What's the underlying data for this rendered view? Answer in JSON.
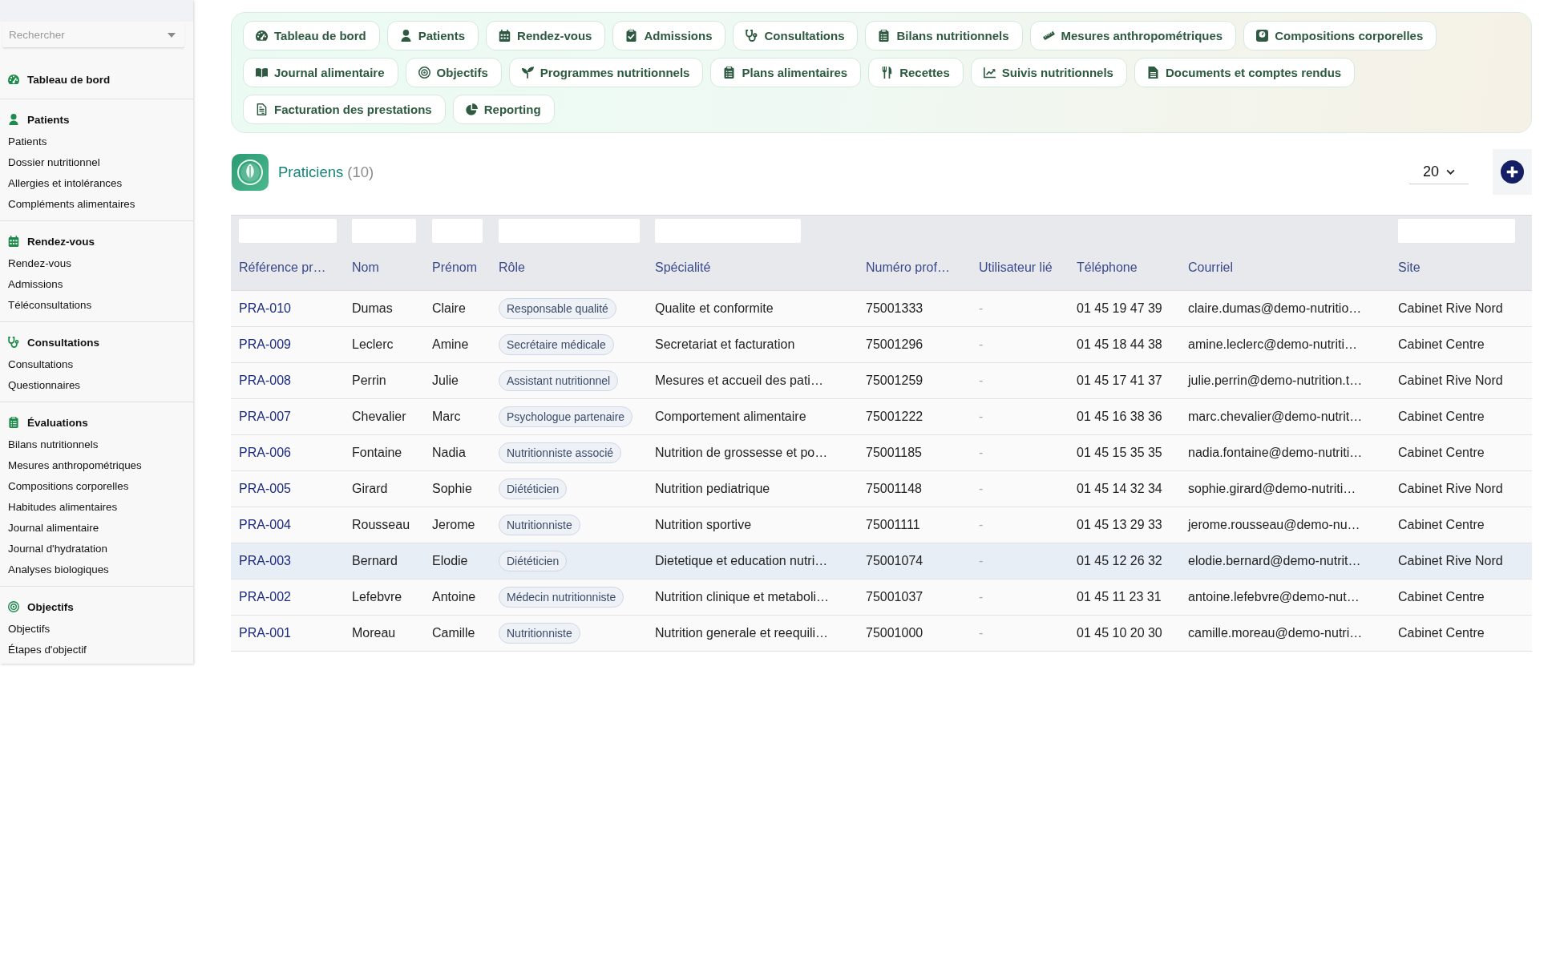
{
  "sidebar": {
    "search": {
      "placeholder": "Rechercher"
    },
    "sections": [
      {
        "title": "Tableau de bord"
      },
      {
        "title": "Patients",
        "items": [
          "Patients",
          "Dossier nutritionnel",
          "Allergies et intolérances",
          "Compléments alimentaires"
        ]
      },
      {
        "title": "Rendez-vous",
        "items": [
          "Rendez-vous",
          "Admissions",
          "Téléconsultations"
        ]
      },
      {
        "title": "Consultations",
        "items": [
          "Consultations",
          "Questionnaires"
        ]
      },
      {
        "title": "Évaluations",
        "items": [
          "Bilans nutritionnels",
          "Mesures anthropométriques",
          "Compositions corporelles",
          "Habitudes alimentaires",
          "Journal alimentaire",
          "Journal d'hydratation",
          "Analyses biologiques"
        ]
      },
      {
        "title": "Objectifs",
        "items": [
          "Objectifs",
          "Étapes d'objectif"
        ]
      }
    ]
  },
  "nav_buttons": [
    "Tableau de bord",
    "Patients",
    "Rendez-vous",
    "Admissions",
    "Consultations",
    "Bilans nutritionnels",
    "Mesures anthropométriques",
    "Compositions corporelles",
    "Journal alimentaire",
    "Objectifs",
    "Programmes nutritionnels",
    "Plans alimentaires",
    "Recettes",
    "Suivis nutritionnels",
    "Documents et comptes rendus",
    "Facturation des prestations",
    "Reporting"
  ],
  "page": {
    "title": "Praticiens",
    "count": "(10)",
    "per_page": "20"
  },
  "table": {
    "columns": [
      {
        "label": "Référence pr…",
        "kind": "link",
        "filter": true
      },
      {
        "label": "Nom",
        "kind": "text",
        "filter": true
      },
      {
        "label": "Prénom",
        "kind": "text",
        "filter": true
      },
      {
        "label": "Rôle",
        "kind": "badge",
        "filter": true
      },
      {
        "label": "Spécialité",
        "kind": "text",
        "filter": true
      },
      {
        "label": "Numéro prof…",
        "kind": "text",
        "filter": false
      },
      {
        "label": "Utilisateur lié",
        "kind": "muted",
        "filter": false
      },
      {
        "label": "Téléphone",
        "kind": "text",
        "filter": false
      },
      {
        "label": "Courriel",
        "kind": "text",
        "filter": false
      },
      {
        "label": "Site",
        "kind": "text",
        "filter": true
      }
    ],
    "rows": [
      {
        "selected": false,
        "cells": [
          "PRA-010",
          "Dumas",
          "Claire",
          "Responsable qualité",
          "Qualite et conformite",
          "75001333",
          "-",
          "01 45 19 47 39",
          "claire.dumas@demo-nutritio…",
          "Cabinet Rive Nord"
        ]
      },
      {
        "selected": false,
        "cells": [
          "PRA-009",
          "Leclerc",
          "Amine",
          "Secrétaire médicale",
          "Secretariat et facturation",
          "75001296",
          "-",
          "01 45 18 44 38",
          "amine.leclerc@demo-nutriti…",
          "Cabinet Centre"
        ]
      },
      {
        "selected": false,
        "cells": [
          "PRA-008",
          "Perrin",
          "Julie",
          "Assistant nutritionnel",
          "Mesures et accueil des pati…",
          "75001259",
          "-",
          "01 45 17 41 37",
          "julie.perrin@demo-nutrition.t…",
          "Cabinet Rive Nord"
        ]
      },
      {
        "selected": false,
        "cells": [
          "PRA-007",
          "Chevalier",
          "Marc",
          "Psychologue partenaire",
          "Comportement alimentaire",
          "75001222",
          "-",
          "01 45 16 38 36",
          "marc.chevalier@demo-nutrit…",
          "Cabinet Centre"
        ]
      },
      {
        "selected": false,
        "cells": [
          "PRA-006",
          "Fontaine",
          "Nadia",
          "Nutritionniste associé",
          "Nutrition de grossesse et po…",
          "75001185",
          "-",
          "01 45 15 35 35",
          "nadia.fontaine@demo-nutriti…",
          "Cabinet Centre"
        ]
      },
      {
        "selected": false,
        "cells": [
          "PRA-005",
          "Girard",
          "Sophie",
          "Diététicien",
          "Nutrition pediatrique",
          "75001148",
          "-",
          "01 45 14 32 34",
          "sophie.girard@demo-nutriti…",
          "Cabinet Rive Nord"
        ]
      },
      {
        "selected": false,
        "cells": [
          "PRA-004",
          "Rousseau",
          "Jerome",
          "Nutritionniste",
          "Nutrition sportive",
          "75001111",
          "-",
          "01 45 13 29 33",
          "jerome.rousseau@demo-nu…",
          "Cabinet Centre"
        ]
      },
      {
        "selected": true,
        "cells": [
          "PRA-003",
          "Bernard",
          "Elodie",
          "Diététicien",
          "Dietetique et education nutri…",
          "75001074",
          "-",
          "01 45 12 26 32",
          "elodie.bernard@demo-nutrit…",
          "Cabinet Rive Nord"
        ]
      },
      {
        "selected": false,
        "cells": [
          "PRA-002",
          "Lefebvre",
          "Antoine",
          "Médecin nutritionniste",
          "Nutrition clinique et metaboli…",
          "75001037",
          "-",
          "01 45 11 23 31",
          "antoine.lefebvre@demo-nut…",
          "Cabinet Centre"
        ]
      },
      {
        "selected": false,
        "cells": [
          "PRA-001",
          "Moreau",
          "Camille",
          "Nutritionniste",
          "Nutrition generale et reequili…",
          "75001000",
          "-",
          "01 45 10 20 30",
          "camille.moreau@demo-nutri…",
          "Cabinet Centre"
        ]
      }
    ]
  }
}
